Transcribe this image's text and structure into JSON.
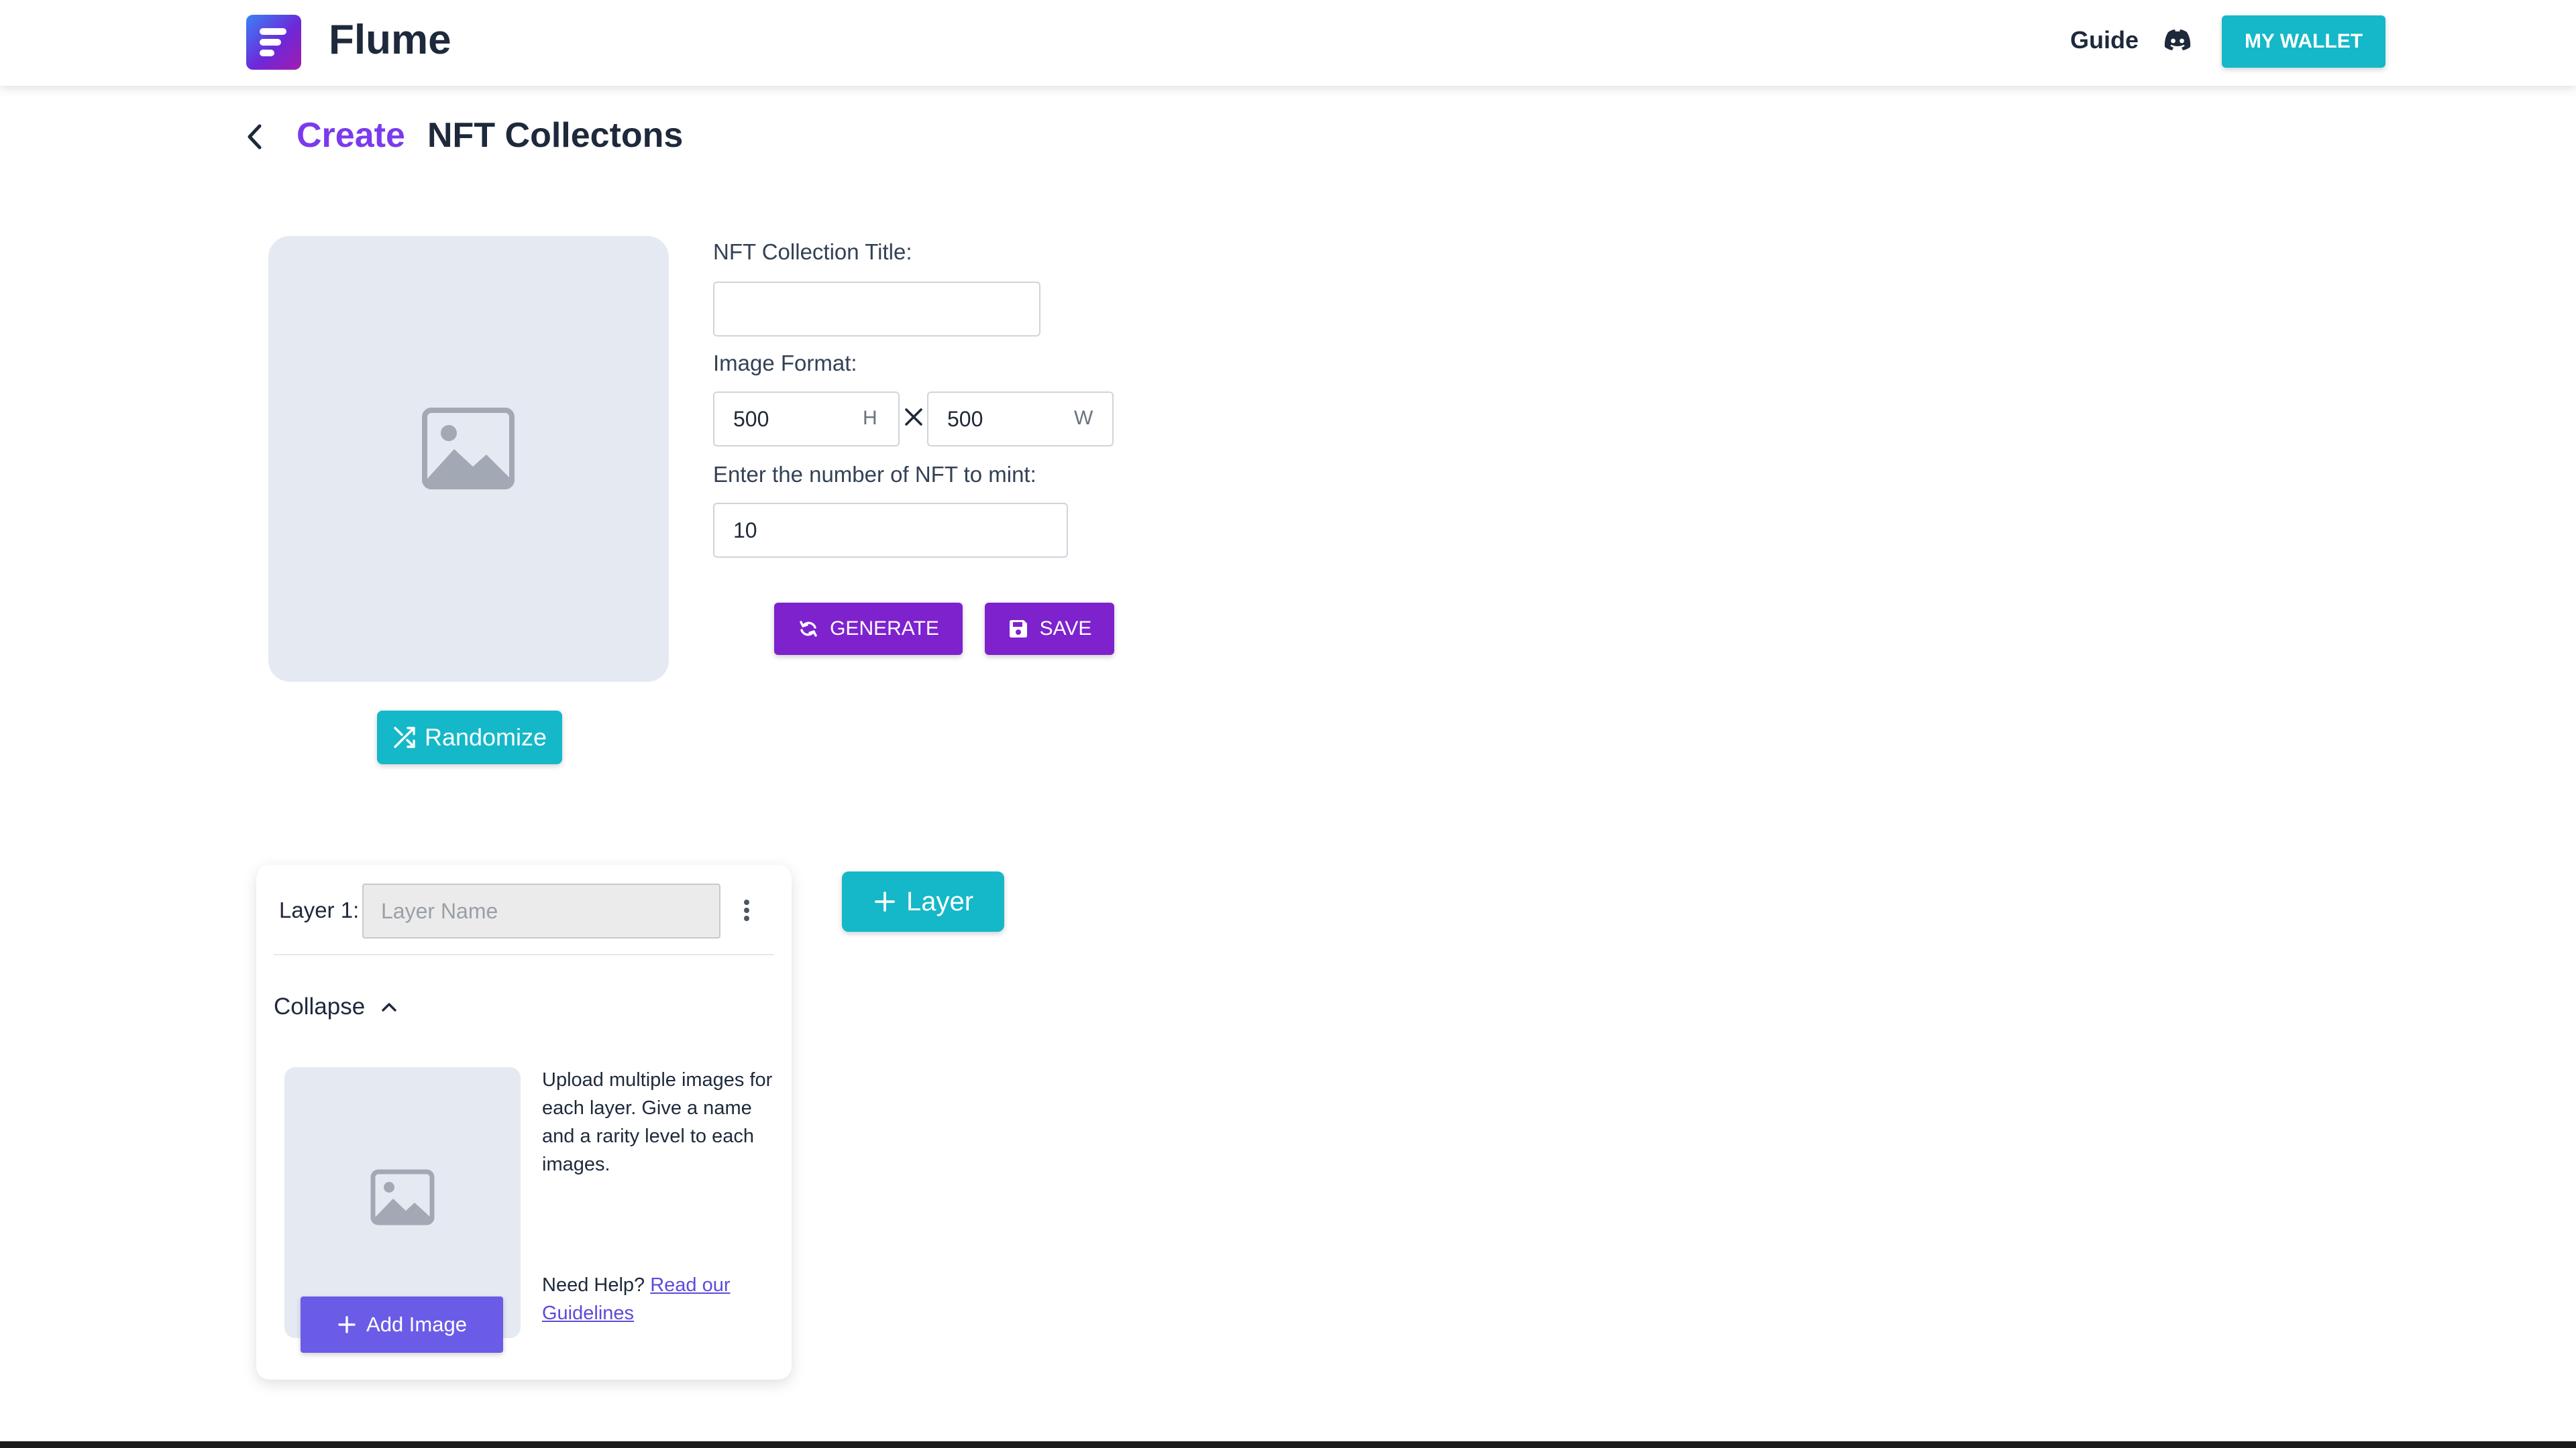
{
  "header": {
    "brand": "Flume",
    "nav_guide": "Guide",
    "wallet_label": "MY WALLET",
    "logo_icon": "flume-logo-icon",
    "discord_icon": "discord-icon"
  },
  "page": {
    "title_create": "Create",
    "title_rest": "NFT Collectons",
    "back_icon": "chevron-left-icon"
  },
  "preview": {
    "image_icon": "image-placeholder-icon",
    "randomize_label": "Randomize"
  },
  "form": {
    "title_label": "NFT Collection Title:",
    "title_value": "",
    "format_label": "Image Format:",
    "height_value": "500",
    "height_suffix": "H",
    "width_value": "500",
    "width_suffix": "W",
    "mint_label": "Enter the number of NFT to mint:",
    "mint_value": "10",
    "generate_label": "GENERATE",
    "save_label": "SAVE"
  },
  "layer": {
    "label": "Layer 1:",
    "name_placeholder": "Layer Name",
    "name_value": "",
    "collapse_label": "Collapse",
    "add_image_label": "Add Image",
    "upload_text": "Upload multiple images for each layer. Give a name and a rarity level to each images.",
    "help_prefix": "Need Help?",
    "help_link": "Read our Guidelines"
  },
  "add_layer_label": "Layer",
  "colors": {
    "accent_purple": "#7e22ce",
    "accent_teal": "#14b8c8",
    "add_image_violet": "#6b5ce7",
    "title_purple": "#7c3aed",
    "link": "#5b4bdb"
  }
}
